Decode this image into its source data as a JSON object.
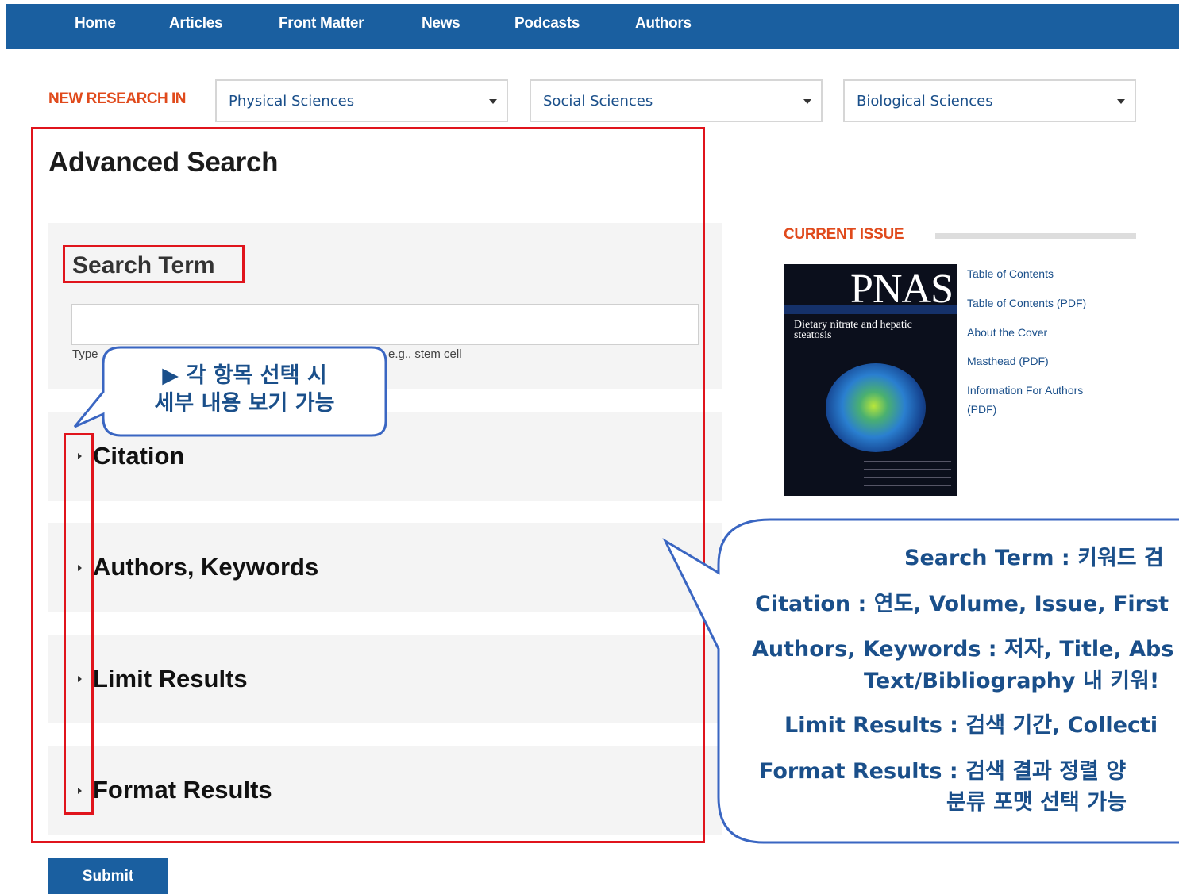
{
  "nav": {
    "items": [
      "Home",
      "Articles",
      "Front Matter",
      "News",
      "Podcasts",
      "Authors"
    ]
  },
  "new_research": {
    "label": "NEW RESEARCH IN",
    "selects": [
      "Physical Sciences",
      "Social Sciences",
      "Biological Sciences"
    ]
  },
  "page_title": "Advanced Search",
  "search_term": {
    "label": "Search Term",
    "value": "",
    "hint_left": "Type",
    "hint_right": "e.g., stem cell"
  },
  "panels": [
    "Citation",
    "Authors, Keywords",
    "Limit Results",
    "Format Results"
  ],
  "submit_label": "Submit",
  "current_issue": {
    "title": "CURRENT ISSUE",
    "cover": {
      "logo": "PNAS",
      "headline": "Dietary nitrate and hepatic steatosis"
    },
    "links": [
      "Table of Contents",
      "Table of Contents (PDF)",
      "About the Cover",
      "Masthead (PDF)",
      "Information For Authors",
      "(PDF)"
    ]
  },
  "callouts": {
    "small": [
      "▶ 각 항목 선택 시",
      "세부 내용 보기 가능"
    ],
    "large": [
      "Search Term : 키워드 검",
      "Citation : 연도, Volume, Issue, First",
      "Authors, Keywords : 저자, Title, Abs",
      "Text/Bibliography 내 키워!",
      "Limit Results : 검색 기간, Collecti",
      "Format Results : 검색 결과 정렬 양",
      "분류 포맷 선택 가능"
    ]
  },
  "colors": {
    "nav_bg": "#1a5fa0",
    "accent_orange": "#e04a1c",
    "highlight_red": "#e0141c",
    "callout_border": "#3a66c2",
    "callout_text": "#1a4f8a"
  }
}
